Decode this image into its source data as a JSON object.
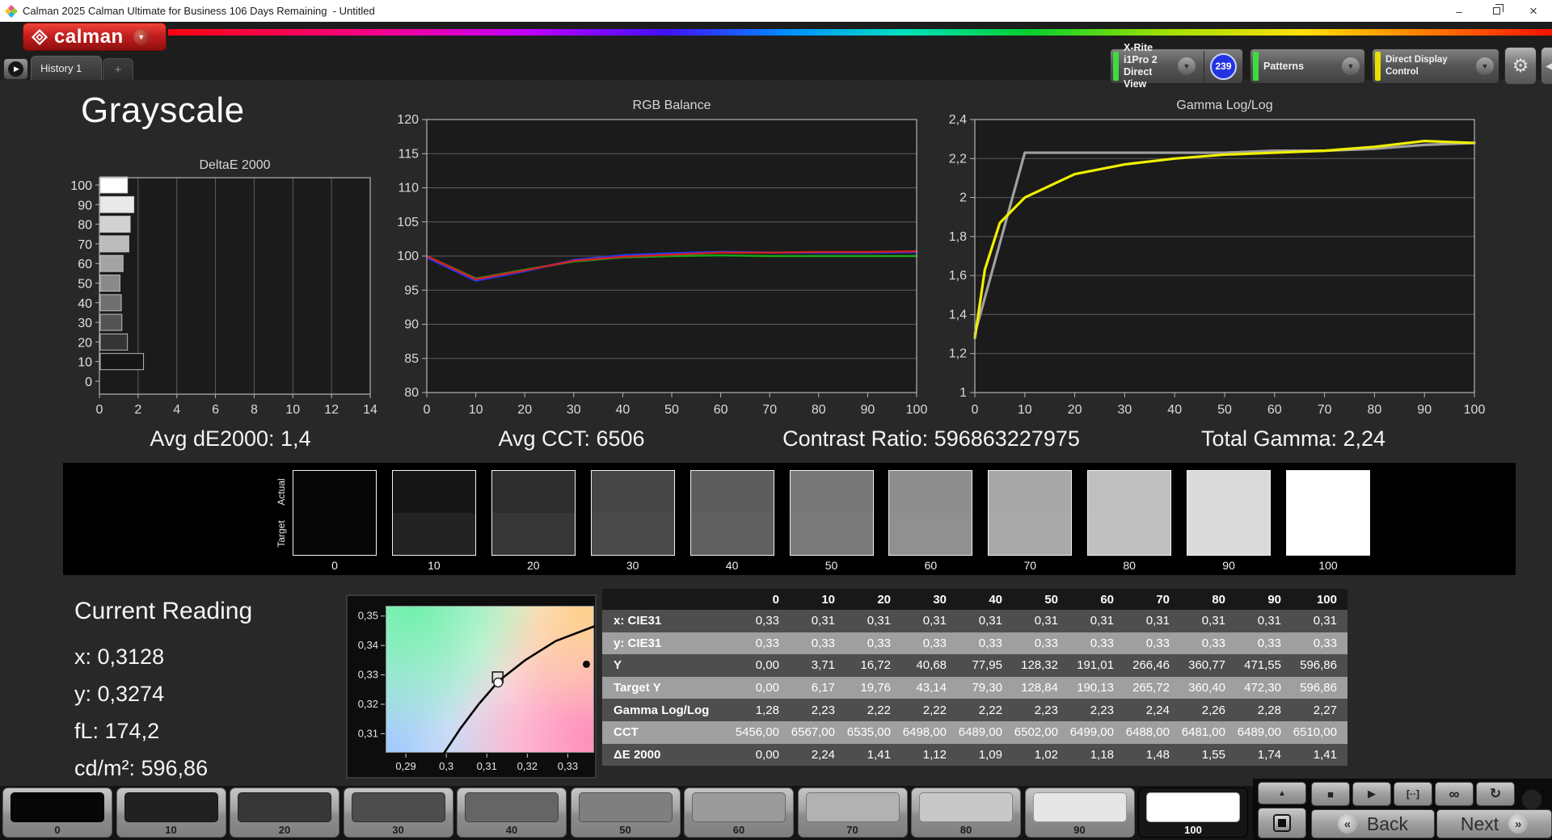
{
  "window": {
    "title": "Calman 2025 Calman Ultimate for Business 106 Days Remaining  - Untitled"
  },
  "icons": {
    "play_tab": "▶",
    "add_tab": "+",
    "dropdown_chevron": "▼",
    "gear": "⚙",
    "collapse_left": "◀",
    "collapse_up": "▲",
    "stop": "■",
    "play": "▶",
    "single_measure": "[··]",
    "continuous": "∞",
    "loop": "↻",
    "back_chevron": "«",
    "next_chevron": "»",
    "minimize": "–",
    "close": "×"
  },
  "header": {
    "logo_text": "calman",
    "tabs": [
      {
        "label": "History 1"
      }
    ],
    "meter": {
      "line1": "X-Rite i1Pro 2",
      "line2": "Direct View",
      "badge": "239",
      "status_color": "#3ddc3d",
      "badge_color": "#2433e0"
    },
    "patterns": {
      "label": "Patterns",
      "status_color": "#3ddc3d"
    },
    "display_control": {
      "label": "Direct Display Control",
      "status_color": "#e8d800"
    }
  },
  "page": {
    "title": "Grayscale"
  },
  "stats": {
    "avg_de": "Avg dE2000: 1,4",
    "avg_cct": "Avg CCT: 6506",
    "contrast": "Contrast Ratio: 596863227975",
    "total_gamma": "Total Gamma: 2,24"
  },
  "strip": {
    "actual_label": "Actual",
    "target_label": "Target",
    "swatches": [
      {
        "level": "0",
        "actual": "#060606",
        "target": "#060606"
      },
      {
        "level": "10",
        "actual": "#161616",
        "target": "#232323"
      },
      {
        "level": "20",
        "actual": "#2d2d2d",
        "target": "#373737"
      },
      {
        "level": "30",
        "actual": "#454545",
        "target": "#4a4a4a"
      },
      {
        "level": "40",
        "actual": "#5c5c5c",
        "target": "#606060"
      },
      {
        "level": "50",
        "actual": "#777777",
        "target": "#7a7a7a"
      },
      {
        "level": "60",
        "actual": "#8e8e8e",
        "target": "#909090"
      },
      {
        "level": "70",
        "actual": "#a8a8a8",
        "target": "#a9a9a9"
      },
      {
        "level": "80",
        "actual": "#bfbfbf",
        "target": "#c0c0c0"
      },
      {
        "level": "90",
        "actual": "#dadada",
        "target": "#dadada"
      },
      {
        "level": "100",
        "actual": "#ffffff",
        "target": "#ffffff"
      }
    ]
  },
  "current_reading": {
    "title": "Current Reading",
    "x": "x: 0,3128",
    "y": "y: 0,3274",
    "fl": "fL: 174,2",
    "cdm2": "cd/m²: 596,86"
  },
  "table": {
    "columns": [
      "",
      "0",
      "10",
      "20",
      "30",
      "40",
      "50",
      "60",
      "70",
      "80",
      "90",
      "100"
    ],
    "rows": [
      {
        "label": "x: CIE31",
        "values": [
          "0,33",
          "0,31",
          "0,31",
          "0,31",
          "0,31",
          "0,31",
          "0,31",
          "0,31",
          "0,31",
          "0,31",
          "0,31"
        ]
      },
      {
        "label": "y: CIE31",
        "values": [
          "0,33",
          "0,33",
          "0,33",
          "0,33",
          "0,33",
          "0,33",
          "0,33",
          "0,33",
          "0,33",
          "0,33",
          "0,33"
        ]
      },
      {
        "label": "Y",
        "values": [
          "0,00",
          "3,71",
          "16,72",
          "40,68",
          "77,95",
          "128,32",
          "191,01",
          "266,46",
          "360,77",
          "471,55",
          "596,86"
        ]
      },
      {
        "label": "Target Y",
        "values": [
          "0,00",
          "6,17",
          "19,76",
          "43,14",
          "79,30",
          "128,84",
          "190,13",
          "265,72",
          "360,40",
          "472,30",
          "596,86"
        ]
      },
      {
        "label": "Gamma Log/Log",
        "values": [
          "1,28",
          "2,23",
          "2,22",
          "2,22",
          "2,22",
          "2,23",
          "2,23",
          "2,24",
          "2,26",
          "2,28",
          "2,27"
        ]
      },
      {
        "label": "CCT",
        "values": [
          "5456,00",
          "6567,00",
          "6535,00",
          "6498,00",
          "6489,00",
          "6502,00",
          "6499,00",
          "6488,00",
          "6481,00",
          "6489,00",
          "6510,00"
        ]
      },
      {
        "label": "ΔE 2000",
        "values": [
          "0,00",
          "2,24",
          "1,41",
          "1,12",
          "1,09",
          "1,02",
          "1,18",
          "1,48",
          "1,55",
          "1,74",
          "1,41"
        ]
      }
    ]
  },
  "bottom_bar": {
    "patches": [
      {
        "label": "0",
        "color": "#060606",
        "selected": false
      },
      {
        "label": "10",
        "color": "#212121",
        "selected": false
      },
      {
        "label": "20",
        "color": "#373737",
        "selected": false
      },
      {
        "label": "30",
        "color": "#4d4d4d",
        "selected": false
      },
      {
        "label": "40",
        "color": "#656565",
        "selected": false
      },
      {
        "label": "50",
        "color": "#7f7f7f",
        "selected": false
      },
      {
        "label": "60",
        "color": "#9b9b9b",
        "selected": false
      },
      {
        "label": "70",
        "color": "#b2b2b2",
        "selected": false
      },
      {
        "label": "80",
        "color": "#c8c8c8",
        "selected": false
      },
      {
        "label": "90",
        "color": "#e6e6e6",
        "selected": false
      },
      {
        "label": "100",
        "color": "#ffffff",
        "selected": true
      }
    ],
    "controls": {
      "back": "Back",
      "next": "Next"
    }
  },
  "chart_data": [
    {
      "id": "deltae2000",
      "type": "bar",
      "orientation": "horizontal",
      "title": "DeltaE 2000",
      "categories": [
        "100",
        "90",
        "80",
        "70",
        "60",
        "50",
        "40",
        "30",
        "20",
        "10",
        "0"
      ],
      "values": [
        1.41,
        1.74,
        1.55,
        1.48,
        1.18,
        1.02,
        1.09,
        1.12,
        1.41,
        2.24,
        0
      ],
      "bar_colors": [
        "#ffffff",
        "#e9e9e9",
        "#d2d2d2",
        "#bcbcbc",
        "#a3a3a3",
        "#8a8a8a",
        "#6f6f6f",
        "#535353",
        "#353535",
        "#161616",
        "#000000"
      ],
      "xlim": [
        0,
        14
      ],
      "xticks": [
        0,
        2,
        4,
        6,
        8,
        10,
        12,
        14
      ],
      "xtick_labels": [
        "0",
        "2",
        "4",
        "6",
        "8",
        "10",
        "12",
        "14"
      ],
      "grid": "vertical"
    },
    {
      "id": "rgb_balance",
      "type": "line",
      "title": "RGB Balance",
      "x": [
        0,
        10,
        20,
        30,
        40,
        50,
        60,
        70,
        80,
        90,
        100
      ],
      "xtick_labels": [
        "0",
        "10",
        "20",
        "30",
        "40",
        "50",
        "60",
        "70",
        "80",
        "90",
        "100"
      ],
      "ylim": [
        80,
        120
      ],
      "ytick_values": [
        80,
        85,
        90,
        95,
        100,
        105,
        110,
        115,
        120
      ],
      "ytick_labels": [
        "80",
        "85",
        "90",
        "95",
        "100",
        "105",
        "110",
        "115",
        "120"
      ],
      "grid": "horizontal",
      "series": [
        {
          "name": "green",
          "color": "#18a818",
          "width": 2.4,
          "values": [
            100.0,
            96.7,
            98.0,
            99.2,
            99.8,
            100.0,
            100.1,
            100.0,
            100.0,
            100.0,
            100.0
          ]
        },
        {
          "name": "blue",
          "color": "#2438f0",
          "width": 2.8,
          "values": [
            99.8,
            96.4,
            97.8,
            99.4,
            100.1,
            100.4,
            100.6,
            100.5,
            100.5,
            100.5,
            100.6
          ]
        },
        {
          "name": "red",
          "color": "#d02020",
          "width": 2.4,
          "values": [
            100.0,
            96.6,
            97.9,
            99.3,
            99.9,
            100.2,
            100.5,
            100.5,
            100.6,
            100.6,
            100.7
          ]
        }
      ]
    },
    {
      "id": "gamma_loglog",
      "type": "line",
      "title": "Gamma Log/Log",
      "x": [
        0,
        10,
        20,
        30,
        40,
        50,
        60,
        70,
        80,
        90,
        100
      ],
      "xtick_labels": [
        "0",
        "10",
        "20",
        "30",
        "40",
        "50",
        "60",
        "70",
        "80",
        "90",
        "100"
      ],
      "ylim": [
        1,
        2.4
      ],
      "ytick_values": [
        1,
        1.2,
        1.4,
        1.6,
        1.8,
        2,
        2.2,
        2.4
      ],
      "ytick_labels": [
        "1",
        "1,2",
        "1,4",
        "1,6",
        "1,8",
        "2",
        "2,2",
        "2,4"
      ],
      "grid": "horizontal",
      "series": [
        {
          "name": "target-gamma",
          "color": "#a0a0a0",
          "width": 3.2,
          "x": [
            0,
            10,
            20,
            30,
            40,
            50,
            60,
            70,
            80,
            90,
            100
          ],
          "values": [
            1.3,
            2.23,
            2.23,
            2.23,
            2.23,
            2.23,
            2.24,
            2.24,
            2.25,
            2.27,
            2.28
          ]
        },
        {
          "name": "measured-gamma",
          "color": "#f0f000",
          "width": 3.2,
          "x": [
            0,
            2,
            5,
            10,
            20,
            30,
            40,
            50,
            60,
            70,
            80,
            90,
            100
          ],
          "values": [
            1.28,
            1.63,
            1.87,
            2.0,
            2.12,
            2.17,
            2.2,
            2.22,
            2.23,
            2.24,
            2.26,
            2.29,
            2.28
          ]
        }
      ]
    },
    {
      "id": "cie_chromaticity",
      "type": "scatter",
      "title": "",
      "xlim": [
        0.285,
        0.3365
      ],
      "ylim": [
        0.3035,
        0.3535
      ],
      "xticks": [
        {
          "v": 0.29,
          "label": "0,29"
        },
        {
          "v": 0.3,
          "label": "0,3"
        },
        {
          "v": 0.31,
          "label": "0,31"
        },
        {
          "v": 0.32,
          "label": "0,32"
        },
        {
          "v": 0.33,
          "label": "0,33"
        }
      ],
      "yticks": [
        {
          "v": 0.31,
          "label": "0,31"
        },
        {
          "v": 0.32,
          "label": "0,32"
        },
        {
          "v": 0.33,
          "label": "0,33"
        },
        {
          "v": 0.34,
          "label": "0,34"
        },
        {
          "v": 0.35,
          "label": "0,35"
        }
      ],
      "locus": [
        [
          0.2995,
          0.3035
        ],
        [
          0.3035,
          0.3118
        ],
        [
          0.308,
          0.32
        ],
        [
          0.313,
          0.328
        ],
        [
          0.3195,
          0.335
        ],
        [
          0.327,
          0.3415
        ],
        [
          0.3365,
          0.3465
        ]
      ],
      "markers": [
        {
          "name": "target",
          "shape": "square",
          "x": 0.3127,
          "y": 0.3292
        },
        {
          "name": "actual",
          "shape": "circle",
          "x": 0.3128,
          "y": 0.3274
        },
        {
          "name": "reference",
          "shape": "dot",
          "x": 0.3346,
          "y": 0.3336
        }
      ]
    }
  ]
}
